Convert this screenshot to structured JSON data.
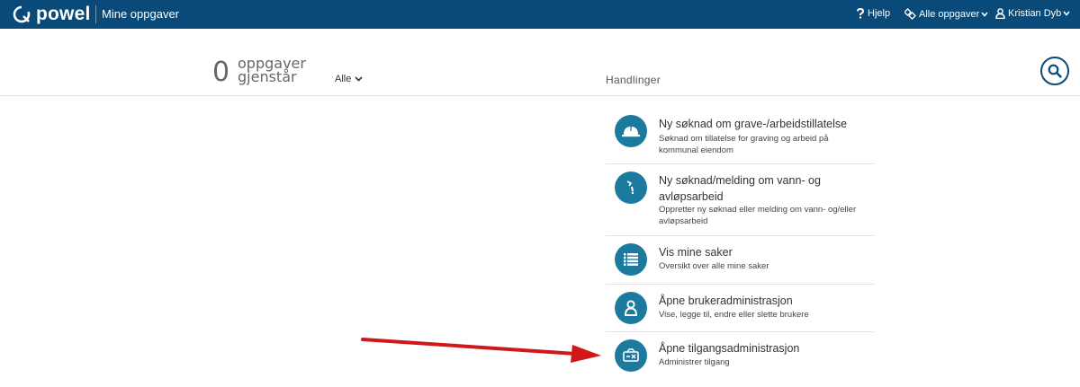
{
  "brand": {
    "name": "powel"
  },
  "app": {
    "title": "Mine oppgaver"
  },
  "topnav": {
    "help": "Hjelp",
    "tasks": "Alle oppgaver",
    "user": "Kristian Dyb"
  },
  "summary": {
    "count": "0",
    "label_line1": "oppgaver",
    "label_line2": "gjenstår",
    "filter": "Alle"
  },
  "actions_title": "Handlinger",
  "actions": [
    {
      "icon": "hardhat-icon",
      "title": "Ny søknad om grave-/arbeidstillatelse",
      "desc": "Søknad om tillatelse for graving og arbeid på kommunal eiendom"
    },
    {
      "icon": "water-tap-icon",
      "title": "Ny søknad/melding om vann- og avløpsarbeid",
      "desc": "Oppretter ny søknad eller melding om vann- og/eller avløpsarbeid"
    },
    {
      "icon": "list-icon",
      "title": "Vis mine saker",
      "desc": "Oversikt over alle mine saker"
    },
    {
      "icon": "user-icon",
      "title": "Åpne brukeradministrasjon",
      "desc": "Vise, legge til, endre eller slette brukere"
    },
    {
      "icon": "access-icon",
      "title": "Åpne tilgangsadministrasjon",
      "desc": "Administrer tilgang"
    }
  ],
  "colors": {
    "topbar": "#0a4a78",
    "accent": "#1c7a9f",
    "arrow": "#d01818"
  }
}
